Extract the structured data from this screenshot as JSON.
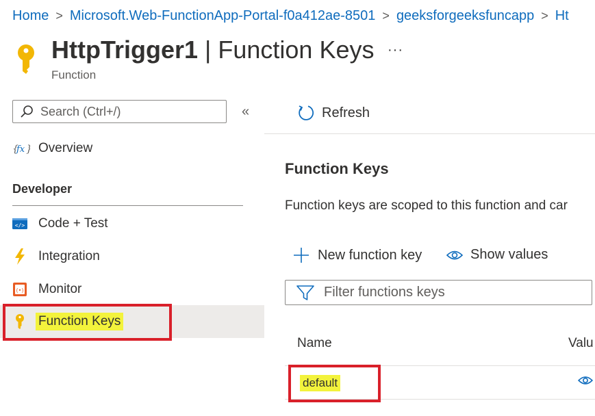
{
  "breadcrumb": {
    "items": [
      "Home",
      "Microsoft.Web-FunctionApp-Portal-f0a412ae-8501",
      "geeksforgeeksfuncapp",
      "Ht"
    ],
    "separator": ">"
  },
  "header": {
    "title_bold": "HttpTrigger1",
    "title_rest": " | Function Keys",
    "more": "···",
    "subtitle": "Function",
    "icon": "key-icon"
  },
  "sidebar": {
    "search_placeholder": "Search (Ctrl+/)",
    "collapse": "«",
    "overview": {
      "label": "Overview",
      "icon": "function-icon"
    },
    "section_developer": "Developer",
    "items": [
      {
        "label": "Code + Test",
        "icon": "code-icon"
      },
      {
        "label": "Integration",
        "icon": "lightning-icon"
      },
      {
        "label": "Monitor",
        "icon": "monitor-icon"
      },
      {
        "label": "Function Keys",
        "icon": "key-icon",
        "selected": true
      }
    ]
  },
  "toolbar": {
    "refresh_label": "Refresh"
  },
  "main": {
    "heading": "Function Keys",
    "description": "Function keys are scoped to this function and car",
    "new_key_label": "New function key",
    "show_values_label": "Show values",
    "filter_placeholder": "Filter functions keys",
    "table": {
      "headers": [
        "Name",
        "Valu"
      ],
      "rows": [
        {
          "name": "default"
        }
      ]
    }
  },
  "colors": {
    "accent": "#0f6cbd",
    "annotation_red": "#d9202a",
    "highlight_yellow": "#f3f33c",
    "key_gold": "#f2b705",
    "selected_bg": "#edebe9"
  }
}
